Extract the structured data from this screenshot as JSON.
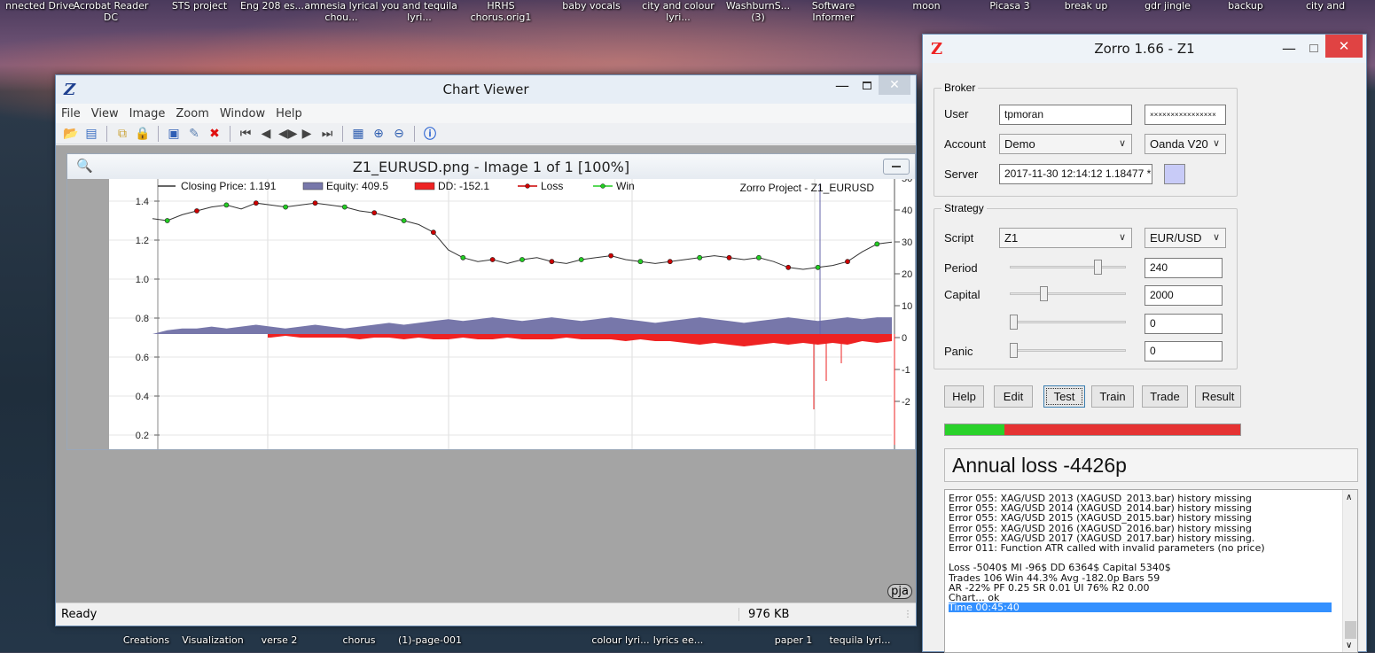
{
  "desktop": {
    "top_icons": [
      "nnected Drive",
      "Acrobat Reader DC",
      "STS project",
      "Eng 208 es...",
      "amnesia lyrical chou...",
      "you and tequila lyri...",
      "HRHS chorus.orig1",
      "baby vocals",
      "city and colour lyri...",
      "WashburnS... (3)",
      "Software Informer",
      "moon",
      "Picasa 3",
      "break up",
      "gdr jingle",
      "backup",
      "city and"
    ],
    "bottom_icons": [
      "Creations",
      "Visualization",
      "verse 2",
      "chorus",
      "(1)-page-001",
      "colour lyri...",
      "lyrics ee...",
      "paper 1",
      "tequila lyri..."
    ]
  },
  "chart_viewer": {
    "title": "Chart Viewer",
    "app_icon": "Z",
    "menu": [
      "File",
      "View",
      "Image",
      "Zoom",
      "Window",
      "Help"
    ],
    "toolbar_icons": [
      "open-folder-icon",
      "open-icon",
      "copy-icon",
      "lock-icon",
      "save-icon",
      "properties-icon",
      "delete-icon",
      "first-icon",
      "prev-icon",
      "slideshow-icon",
      "next-icon",
      "last-icon",
      "grid-icon",
      "zoom-in-icon",
      "zoom-out-icon",
      "info-icon"
    ],
    "image_title": "Z1_EURUSD.png - Image 1 of 1 [100%]",
    "status_left": "Ready",
    "status_size": "976 KB",
    "watermark": "pja"
  },
  "chart_data": {
    "type": "line",
    "title": "Zorro Project - Z1_EURUSD",
    "legend": [
      {
        "label": "Closing Price: 1.191",
        "color": "#333333"
      },
      {
        "label": "Equity: 409.5",
        "color": "#7777aa"
      },
      {
        "label": "DD: -152.1",
        "color": "#ee2222"
      },
      {
        "label": "Loss",
        "color": "#cc0000"
      },
      {
        "label": "Win",
        "color": "#22cc22"
      }
    ],
    "legend_position": "top",
    "y_left_ticks": [
      "1.4",
      "1.2",
      "1.0",
      "0.8",
      "0.6",
      "0.4",
      "0.2"
    ],
    "y_right_ticks": [
      "50",
      "40",
      "30",
      "20",
      "10",
      "0",
      "-1",
      "-2"
    ],
    "price_series": [
      1.31,
      1.3,
      1.33,
      1.35,
      1.37,
      1.38,
      1.36,
      1.39,
      1.38,
      1.37,
      1.38,
      1.39,
      1.38,
      1.37,
      1.35,
      1.34,
      1.32,
      1.3,
      1.28,
      1.24,
      1.15,
      1.11,
      1.09,
      1.1,
      1.08,
      1.1,
      1.11,
      1.09,
      1.08,
      1.1,
      1.11,
      1.12,
      1.1,
      1.09,
      1.08,
      1.09,
      1.1,
      1.11,
      1.12,
      1.11,
      1.1,
      1.11,
      1.09,
      1.06,
      1.05,
      1.06,
      1.07,
      1.09,
      1.14,
      1.18,
      1.19
    ],
    "equity_series": [
      0,
      2,
      3,
      3,
      4,
      3,
      4,
      5,
      4,
      3,
      4,
      5,
      4,
      3,
      4,
      5,
      6,
      5,
      6,
      7,
      8,
      7,
      8,
      9,
      8,
      7,
      8,
      9,
      8,
      7,
      8,
      9,
      8,
      7,
      6,
      7,
      8,
      9,
      8,
      7,
      6,
      7,
      8,
      9,
      8,
      7,
      8,
      9,
      8,
      9,
      9
    ],
    "drawdown_series": [
      0,
      -1,
      -2,
      -2,
      -2,
      -1,
      -2,
      -2,
      -2,
      -1,
      -2,
      -2,
      -2,
      -2,
      -3,
      -2,
      -2,
      -3,
      -2,
      -3,
      -3,
      -2,
      -3,
      -3,
      -2,
      -3,
      -3,
      -3,
      -2,
      -3,
      -3,
      -3,
      -4,
      -3,
      -4,
      -4,
      -5,
      -6,
      -5,
      -6,
      -7,
      -6,
      -5,
      -6,
      -5,
      -6,
      -5,
      -6,
      -4,
      -5,
      -4
    ]
  },
  "zorro": {
    "title": "Zorro 1.66 - Z1",
    "app_icon": "Z",
    "broker": {
      "legend": "Broker",
      "user_label": "User",
      "user_value": "tpmoran",
      "password_value": "××××××××××××××××",
      "account_label": "Account",
      "account_value": "Demo",
      "broker_value": "Oanda V20",
      "server_label": "Server",
      "server_value": "2017-11-30 12:14:12  1.18477 *"
    },
    "strategy": {
      "legend": "Strategy",
      "script_label": "Script",
      "script_value": "Z1",
      "asset_value": "EUR/USD",
      "period_label": "Period",
      "period_value": "240",
      "period_level": 0.78,
      "capital_label": "Capital",
      "capital_value": "2000",
      "capital_level": 0.28,
      "extra_value": "0",
      "extra_level": 0.0,
      "panic_label": "Panic",
      "panic_value": "0",
      "panic_level": 0.0
    },
    "buttons": [
      "Help",
      "Edit",
      "Test",
      "Train",
      "Trade",
      "Result"
    ],
    "progress": 0.2,
    "progress_colors": {
      "done": "#29d12a",
      "remaining": "#e53333"
    },
    "annual": "Annual loss -4426p",
    "log": [
      "Error 055: XAG/USD 2013 (XAGUSD_2013.bar) history missing",
      "Error 055: XAG/USD 2014 (XAGUSD_2014.bar) history missing",
      "Error 055: XAG/USD 2015 (XAGUSD_2015.bar) history missing",
      "Error 055: XAG/USD 2016 (XAGUSD_2016.bar) history missing",
      "Error 055: XAG/USD 2017 (XAGUSD_2017.bar) history missing.",
      "Error 011: Function ATR called with invalid parameters (no price)",
      "",
      "Loss -5040$  MI -96$  DD 6364$  Capital 5340$",
      "Trades 106  Win 44.3%  Avg -182.0p  Bars 59",
      "AR -22%  PF 0.25  SR 0.01  UI 76%  R2 0.00",
      "Chart... ok",
      "Time 00:45:40"
    ]
  }
}
